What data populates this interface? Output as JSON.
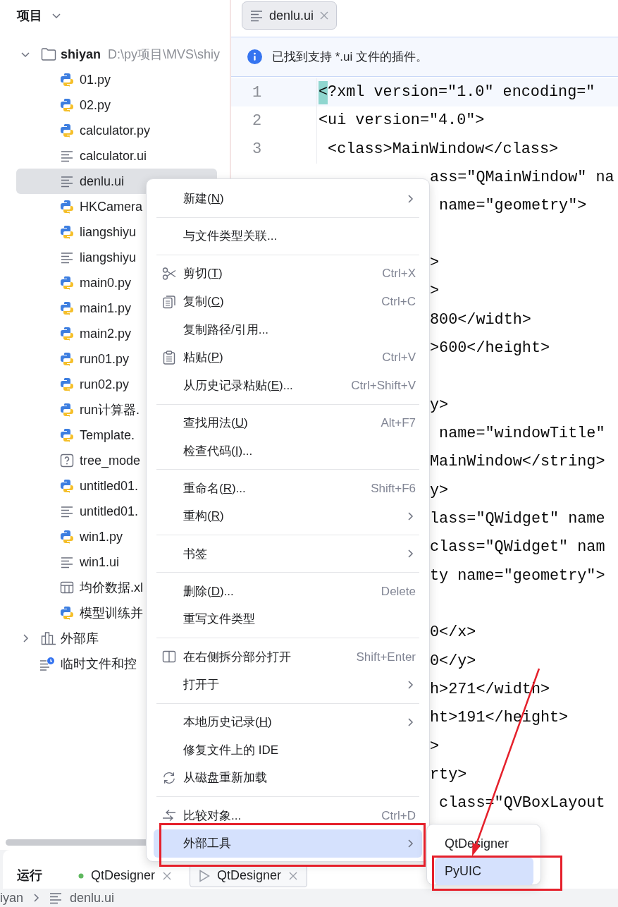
{
  "project_panel": {
    "title": "项目"
  },
  "tree": [
    {
      "kind": "folder",
      "name": "shiyan",
      "path": "D:\\py项目\\MVS\\shiy",
      "expanded": true,
      "selected": false,
      "children": [
        {
          "kind": "python",
          "name": "01.py",
          "selected": false
        },
        {
          "kind": "python",
          "name": "02.py",
          "selected": false
        },
        {
          "kind": "python",
          "name": "calculator.py",
          "selected": false
        },
        {
          "kind": "ui",
          "name": "calculator.ui",
          "selected": false
        },
        {
          "kind": "ui",
          "name": "denlu.ui",
          "selected": true
        },
        {
          "kind": "python",
          "name": "HKCamera",
          "selected": false
        },
        {
          "kind": "python",
          "name": "liangshiyu",
          "selected": false
        },
        {
          "kind": "ui",
          "name": "liangshiyu",
          "selected": false
        },
        {
          "kind": "python",
          "name": "main0.py",
          "selected": false
        },
        {
          "kind": "python",
          "name": "main1.py",
          "selected": false
        },
        {
          "kind": "python",
          "name": "main2.py",
          "selected": false
        },
        {
          "kind": "python",
          "name": "run01.py",
          "selected": false
        },
        {
          "kind": "python",
          "name": "run02.py",
          "selected": false
        },
        {
          "kind": "python",
          "name": "run计算器.",
          "selected": false
        },
        {
          "kind": "python",
          "name": "Template.",
          "selected": false
        },
        {
          "kind": "unknown",
          "name": "tree_mode",
          "selected": false
        },
        {
          "kind": "python",
          "name": "untitled01.",
          "selected": false
        },
        {
          "kind": "ui",
          "name": "untitled01.",
          "selected": false
        },
        {
          "kind": "python",
          "name": "win1.py",
          "selected": false
        },
        {
          "kind": "ui",
          "name": "win1.ui",
          "selected": false
        },
        {
          "kind": "table",
          "name": "均价数据.xl",
          "selected": false
        },
        {
          "kind": "python",
          "name": "模型训练并",
          "selected": false
        }
      ]
    },
    {
      "kind": "library",
      "name": "外部库",
      "expanded": false,
      "selected": false
    },
    {
      "kind": "scratch",
      "name": "临时文件和控",
      "selected": false
    }
  ],
  "editor_tabs": [
    {
      "label": "denlu.ui",
      "selected": true
    }
  ],
  "notice": {
    "text": "已找到支持 *.ui 文件的插件。"
  },
  "code_lines": [
    {
      "number": "1",
      "text": "<?xml version=\"1.0\" encoding=\"",
      "current": true
    },
    {
      "number": "2",
      "text": "<ui version=\"4.0\">"
    },
    {
      "number": "3",
      "text": " <class>MainWindow</class>"
    }
  ],
  "covered_lines": [
    {
      "kind": "text",
      "text": "ass=\"QMainWindow\" na"
    },
    {
      "kind": "text",
      "text": " name=\"geometry\">"
    },
    {
      "kind": "blank"
    },
    {
      "kind": "text",
      "text": ">"
    },
    {
      "kind": "text",
      "text": ">"
    },
    {
      "kind": "text",
      "text": "800</width>"
    },
    {
      "kind": "text",
      "text": ">600</height>"
    },
    {
      "kind": "blank"
    },
    {
      "kind": "text",
      "text": "y>"
    },
    {
      "kind": "text",
      "text": " name=\"windowTitle\""
    },
    {
      "kind": "text",
      "text": "MainWindow</string>"
    },
    {
      "kind": "text",
      "text": "y>"
    },
    {
      "kind": "text",
      "text": "lass=\"QWidget\" name"
    },
    {
      "kind": "text",
      "text": "class=\"QWidget\" nam"
    },
    {
      "kind": "text",
      "text": "ty name=\"geometry\">"
    },
    {
      "kind": "blank"
    },
    {
      "kind": "text",
      "text": "0</x>"
    },
    {
      "kind": "text",
      "text": "0</y>"
    },
    {
      "kind": "text",
      "text": "h>271</width>"
    },
    {
      "kind": "text",
      "text": "ht>191</height>"
    },
    {
      "kind": "text",
      "text": ">"
    },
    {
      "kind": "text",
      "text": "rty>"
    },
    {
      "kind": "text",
      "text": " class=\"QVBoxLayout"
    }
  ],
  "context_menu": {
    "items": [
      {
        "kind": "plain",
        "label": "新建(",
        "mnemonic": "N",
        "label_end": ")",
        "submenu": true,
        "selected": false
      },
      {
        "kind": "separator"
      },
      {
        "kind": "plain",
        "label": "与文件类型关联...",
        "submenu": false,
        "selected": false
      },
      {
        "kind": "separator"
      },
      {
        "kind": "cut",
        "label": "剪切(",
        "mnemonic": "T",
        "label_end": ")",
        "shortcut": "Ctrl+X",
        "submenu": false,
        "selected": false
      },
      {
        "kind": "copy",
        "label": "复制(",
        "mnemonic": "C",
        "label_end": ")",
        "shortcut": "Ctrl+C",
        "submenu": false,
        "selected": false
      },
      {
        "kind": "plain",
        "label": "复制路径/引用...",
        "submenu": false,
        "selected": false
      },
      {
        "kind": "paste",
        "label": "粘贴(",
        "mnemonic": "P",
        "label_end": ")",
        "shortcut": "Ctrl+V",
        "submenu": false,
        "selected": false
      },
      {
        "kind": "plain",
        "label": "从历史记录粘贴(",
        "mnemonic": "E",
        "label_end": ")...",
        "shortcut": "Ctrl+Shift+V",
        "submenu": false,
        "selected": false
      },
      {
        "kind": "separator"
      },
      {
        "kind": "plain",
        "label": "查找用法(",
        "mnemonic": "U",
        "label_end": ")",
        "shortcut": "Alt+F7",
        "submenu": false,
        "selected": false
      },
      {
        "kind": "plain",
        "label": "检查代码(",
        "mnemonic": "I",
        "label_end": ")...",
        "submenu": false,
        "selected": false
      },
      {
        "kind": "separator"
      },
      {
        "kind": "plain",
        "label": "重命名(",
        "mnemonic": "R",
        "label_end": ")...",
        "shortcut": "Shift+F6",
        "submenu": false,
        "selected": false
      },
      {
        "kind": "plain",
        "label": "重构(",
        "mnemonic": "R",
        "label_end": ")",
        "submenu": true,
        "selected": false
      },
      {
        "kind": "separator"
      },
      {
        "kind": "plain",
        "label": "书签",
        "submenu": true,
        "selected": false
      },
      {
        "kind": "separator"
      },
      {
        "kind": "plain",
        "label": "删除(",
        "mnemonic": "D",
        "label_end": ")...",
        "shortcut": "Delete",
        "submenu": false,
        "selected": false
      },
      {
        "kind": "plain",
        "label": "重写文件类型",
        "submenu": false,
        "selected": false
      },
      {
        "kind": "separator"
      },
      {
        "kind": "split",
        "label": "在右侧拆分部分打开",
        "shortcut": "Shift+Enter",
        "submenu": false,
        "selected": false
      },
      {
        "kind": "plain",
        "label": "打开于",
        "submenu": true,
        "selected": false
      },
      {
        "kind": "separator"
      },
      {
        "kind": "plain",
        "label": "本地历史记录(",
        "mnemonic": "H",
        "label_end": ")",
        "submenu": true,
        "selected": false
      },
      {
        "kind": "plain",
        "label": "修复文件上的 IDE",
        "submenu": false,
        "selected": false
      },
      {
        "kind": "reload",
        "label": "从磁盘重新加载",
        "submenu": false,
        "selected": false
      },
      {
        "kind": "separator"
      },
      {
        "kind": "compare",
        "label": "比较对象...",
        "shortcut": "Ctrl+D",
        "submenu": false,
        "selected": false
      },
      {
        "kind": "plain",
        "label": "外部工具",
        "submenu": true,
        "selected": true
      }
    ]
  },
  "submenu": {
    "items": [
      {
        "label": "QtDesigner",
        "selected": false
      },
      {
        "label": "PyUIC",
        "selected": true
      }
    ]
  },
  "run_panel": {
    "title": "运行",
    "tabs": [
      {
        "kind": "dot",
        "label": "QtDesigner",
        "selected": false
      },
      {
        "kind": "play",
        "label": "QtDesigner",
        "selected": true
      }
    ]
  },
  "breadcrumb": [
    {
      "kind": "folder",
      "label": "iyan"
    },
    {
      "kind": "file",
      "label": "denlu.ui"
    }
  ]
}
